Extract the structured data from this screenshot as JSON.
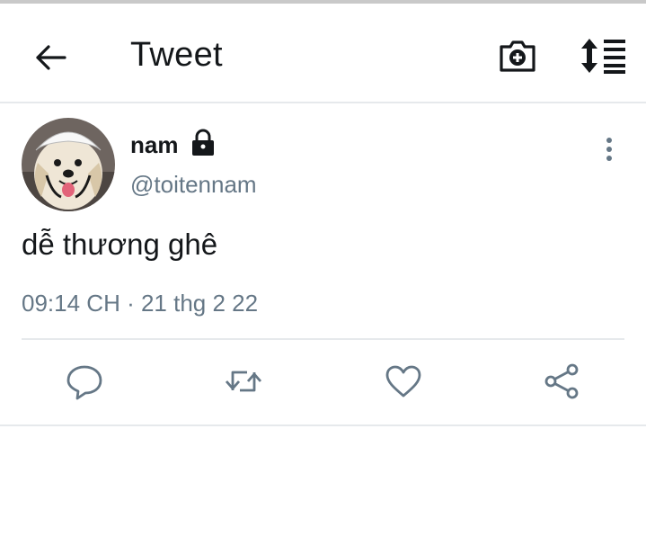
{
  "header": {
    "title": "Tweet",
    "icons": [
      "back-arrow-icon",
      "camera-plus-icon",
      "sort-icon"
    ]
  },
  "tweet": {
    "author": {
      "name": "nam",
      "handle": "@toitennam",
      "protected_icon": "lock-icon",
      "avatar": "dog-avatar"
    },
    "text": "dễ thương ghê",
    "timestamp": "09:14 CH · 21 thg 2 22"
  },
  "actions": [
    "reply-icon",
    "retweet-icon",
    "like-icon",
    "share-icon"
  ],
  "colors": {
    "text": "#14171a",
    "secondary": "#657786",
    "divider": "#e6e9ec"
  }
}
